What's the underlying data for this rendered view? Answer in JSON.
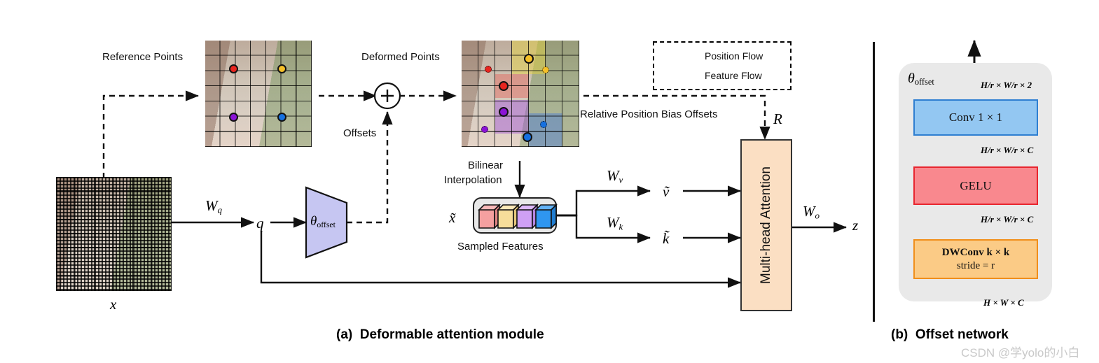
{
  "figure": {
    "captions": [
      {
        "id": "a",
        "prefix": "(a)",
        "text": "Deformable attention module"
      },
      {
        "id": "b",
        "prefix": "(b)",
        "text": "Offset network"
      }
    ],
    "watermark": "CSDN @学yolo的小白"
  },
  "panel_a": {
    "labels": {
      "reference_points": "Reference Points",
      "deformed_points": "Deformed Points",
      "offsets": "Offsets",
      "relative_position_bias": "Relative Position Bias Offsets",
      "bilinear": "Bilinear",
      "interpolation": "Interpolation",
      "sampled_features": "Sampled Features"
    },
    "math": {
      "input_x": "x",
      "Wq": "W",
      "Wq_sub": "q",
      "q": "q",
      "theta_offset": "θ",
      "theta_offset_sub": "offset",
      "x_tilde": "x̃",
      "Wv": "W",
      "Wv_sub": "v",
      "Wk": "W",
      "Wk_sub": "k",
      "v_tilde": "ṽ",
      "k_tilde": "k̃",
      "R": "R",
      "Wo": "W",
      "Wo_sub": "o",
      "z": "z",
      "plus": "+"
    },
    "attention_block": {
      "label": "Multi-head Attention",
      "color": "#fbdfc3"
    },
    "legend": {
      "box_style": "dashed",
      "entries": [
        {
          "style": "dashed",
          "label": "Position Flow"
        },
        {
          "style": "solid",
          "label": "Feature Flow"
        }
      ]
    },
    "reference_points_dots": [
      {
        "name": "red",
        "color": "#e8251f",
        "x": 0.285,
        "y": 0.275
      },
      {
        "name": "yellow",
        "color": "#f5c028",
        "x": 0.715,
        "y": 0.275
      },
      {
        "name": "purple",
        "color": "#8b13d6",
        "x": 0.285,
        "y": 0.725
      },
      {
        "name": "blue",
        "color": "#1570e0",
        "x": 0.715,
        "y": 0.725
      }
    ],
    "deformed_points_dots": [
      {
        "name": "red",
        "color": "#e8251f",
        "from_x": 0.285,
        "from_y": 0.275,
        "to_x": 0.415,
        "to_y": 0.4
      },
      {
        "name": "yellow",
        "color": "#f5c028",
        "from_x": 0.715,
        "from_y": 0.275,
        "to_x": 0.58,
        "to_y": 0.175
      },
      {
        "name": "purple",
        "color": "#8b13d6",
        "from_x": 0.285,
        "from_y": 0.725,
        "to_x": 0.41,
        "to_y": 0.6
      },
      {
        "name": "blue",
        "color": "#1570e0",
        "from_x": 0.715,
        "from_y": 0.725,
        "to_x": 0.585,
        "to_y": 0.83
      }
    ],
    "sampled_feature_cubes": [
      {
        "name": "cube-red",
        "color": "#f5a0a0"
      },
      {
        "name": "cube-yellow",
        "color": "#f7dd9a"
      },
      {
        "name": "cube-purple",
        "color": "#cfa0f5"
      },
      {
        "name": "cube-blue",
        "color": "#2f96f0"
      }
    ],
    "theta_offset_color": "#c6c6f2"
  },
  "panel_b": {
    "group_label": {
      "symbol": "θ",
      "sub": "offset"
    },
    "layers": [
      {
        "name": "conv1x1",
        "label": "Conv 1 × 1",
        "fill": "#93c7f2",
        "stroke": "#2f7fd1"
      },
      {
        "name": "gelu",
        "label": "GELU",
        "fill": "#f9888e",
        "stroke": "#e8262f"
      },
      {
        "name": "dwconv",
        "label": "DWConv k × k",
        "label2": "stride = r",
        "fill": "#fbcb86",
        "stroke": "#f08f1b"
      }
    ],
    "tensor_shapes": [
      {
        "name": "output-shape",
        "text": "H/r × W/r × 2"
      },
      {
        "name": "conv-input-shape",
        "text": "H/r × W/r × C"
      },
      {
        "name": "gelu-input-shape",
        "text": "H/r × W/r × C"
      },
      {
        "name": "network-input-shape",
        "text": "H × W × C"
      }
    ]
  }
}
